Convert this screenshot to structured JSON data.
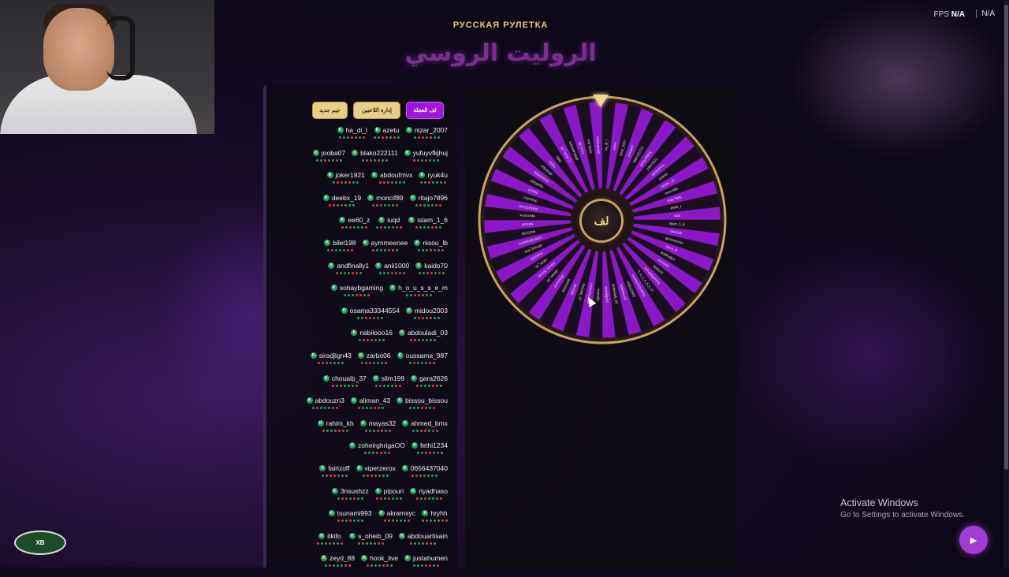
{
  "header": {
    "subtitle": "РУССКАЯ РУЛЕТКА",
    "title": "الروليت الروسي",
    "fps_label": "FPS",
    "fps_value": "N/A",
    "stream_label": "N/A"
  },
  "toolbar": {
    "spin_label": "لف العجلة",
    "manage_label": "إدارة اللاعبين",
    "new_round_label": "جيم جديد"
  },
  "colors": {
    "accent": "#a016d8",
    "gold": "#e8cf88",
    "kick_badge": "#1fa05a"
  },
  "players": [
    [
      "ha_di_l",
      "azetu",
      "nizar_2007"
    ],
    [
      "jooba07",
      "blako222111",
      "yufuyvfkjhuj"
    ],
    [
      "joker1921",
      "abdoufmvx",
      "ryuk4u"
    ],
    [
      "deebx_19",
      "moncif89",
      "ritajo7896"
    ],
    [
      "ee60_z",
      "iuqd",
      "islam_1_6"
    ],
    [
      "bilel198",
      "aymmeenee",
      "nisou_lb"
    ],
    [
      "andfinally1",
      "anii1000",
      "kaido70"
    ],
    [
      "sohaybgaming",
      "h_o_u_s_s_e_m"
    ],
    [
      "osama33344554",
      "midou2003"
    ],
    [
      "nabilooo16",
      "abdouladi_03"
    ],
    [
      "siradjlgn43",
      "zarbo06",
      "oussama_987"
    ],
    [
      "chouaib_37",
      "slim199",
      "gara2626"
    ],
    [
      "abdouzn3",
      "aliman_43",
      "bissou_bissou"
    ],
    [
      "rahim_kh",
      "mayas32",
      "ahmed_bmx"
    ],
    [
      "zoheirghrigaOO",
      "fethi1234"
    ],
    [
      "fairizoff",
      "viperzerox",
      "0656437040"
    ],
    [
      "3nsushzz",
      "pipouri",
      "riyadhaso"
    ],
    [
      "tsunami993",
      "akramsyc",
      "hryhh"
    ],
    [
      "itkifo",
      "s_oheib_09",
      "abdouartisain"
    ],
    [
      "zeyd_88",
      "hook_live",
      "justahumen"
    ]
  ],
  "kick_badge_letter": "K",
  "wheel": {
    "center_label": "لف",
    "segment_count": 56
  },
  "watermark": {
    "line1": "Activate Windows",
    "line2": "Go to Settings to activate Windows."
  },
  "logo_text": "XB",
  "fab_icon": "megaphone-icon"
}
